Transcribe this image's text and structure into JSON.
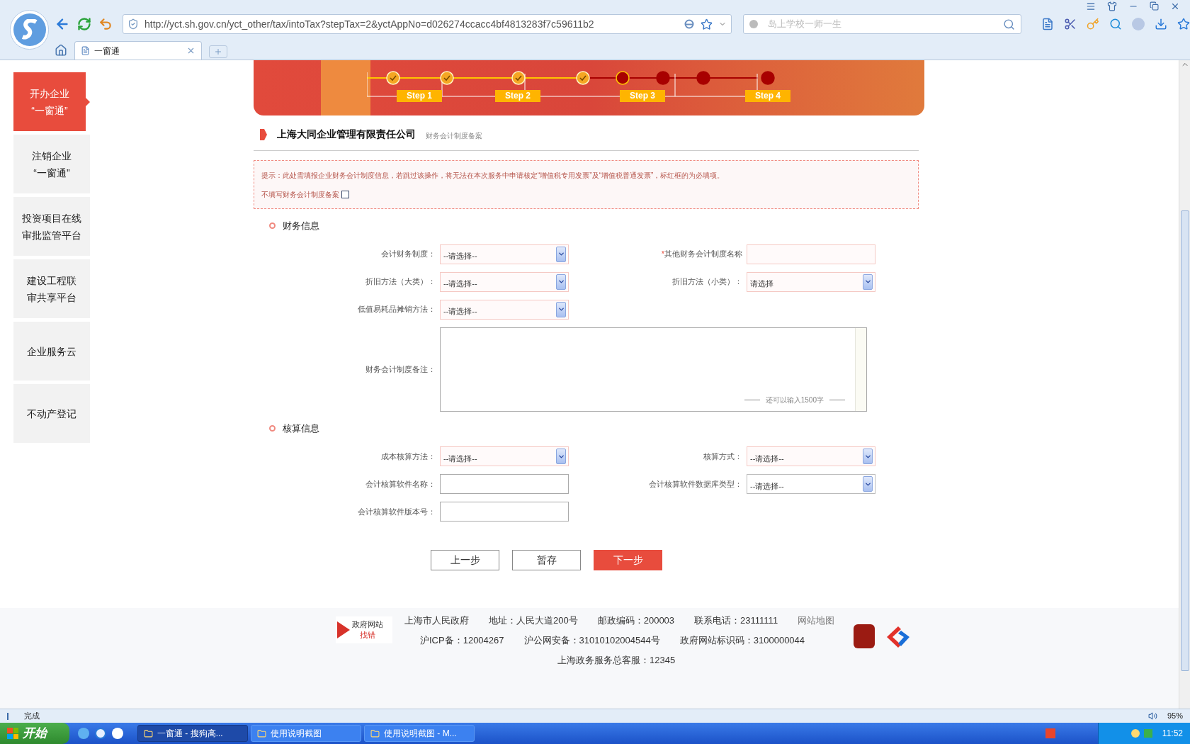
{
  "browser": {
    "address": "http://yct.sh.gov.cn/yct_other/tax/intoTax?stepTax=2&yctAppNo=d026274ccacc4bf4813283f7c59611b2",
    "search_placeholder": "岛上学校一师一生",
    "tabs": [
      {
        "label": "一窗通",
        "selected": true
      }
    ]
  },
  "sidebar": {
    "items": [
      {
        "lines": [
          "开办企业",
          "“一窗通”"
        ],
        "selected": true
      },
      {
        "lines": [
          "注销企业",
          "“一窗通”"
        ],
        "selected": false
      },
      {
        "lines": [
          "投资项目在线",
          "审批监管平台"
        ],
        "selected": false
      },
      {
        "lines": [
          "建设工程联",
          "审共享平台"
        ],
        "selected": false
      },
      {
        "lines": [
          "企业服务云"
        ],
        "selected": false
      },
      {
        "lines": [
          "不动产登记"
        ],
        "selected": false
      }
    ]
  },
  "progress": {
    "steps": [
      {
        "done": true,
        "current": false
      },
      {
        "done": true,
        "current": false
      },
      {
        "done": true,
        "current": false
      },
      {
        "done": true,
        "current": false
      },
      {
        "done": false,
        "current": true
      },
      {
        "done": false,
        "current": false
      },
      {
        "done": false,
        "current": false
      },
      {
        "done": false,
        "current": false
      }
    ],
    "labels": [
      "Step 1",
      "Step 2",
      "Step 3",
      "Step 4"
    ]
  },
  "company": {
    "name": "上海大同企业管理有限责任公司",
    "subtitle": "财务会计制度备案"
  },
  "notice": {
    "text": "提示：此处需填报企业财务会计制度信息，若跳过该操作，将无法在本次服务中申请核定“增值税专用发票”及“增值税普通发票”，标红框的为必填项。",
    "skip_label": "不填写财务会计制度备案",
    "skip_checked": false
  },
  "sections": [
    {
      "title": "财务信息",
      "rows": [
        [
          {
            "label": "会计财务制度：",
            "kind": "select",
            "value": "--请选择--",
            "required": true
          },
          {
            "label": "其他财务会计制度名称",
            "kind": "input",
            "required": true,
            "star": "*"
          }
        ],
        [
          {
            "label": "折旧方法（大类）：",
            "kind": "select",
            "value": "--请选择--",
            "required": true
          },
          {
            "label": "折旧方法（小类）：",
            "kind": "select",
            "value": "请选择",
            "required": true
          }
        ],
        [
          {
            "label": "低值易耗品摊销方法：",
            "kind": "select",
            "value": "--请选择--",
            "required": true
          }
        ],
        [
          {
            "label": "财务会计制度备注：",
            "kind": "textarea",
            "counter": "还可以输入1500字",
            "required": false
          }
        ]
      ]
    },
    {
      "title": "核算信息",
      "rows": [
        [
          {
            "label": "成本核算方法：",
            "kind": "select",
            "value": "--请选择--",
            "required": true
          },
          {
            "label": "核算方式：",
            "kind": "select",
            "value": "--请选择--",
            "required": true
          }
        ],
        [
          {
            "label": "会计核算软件名称：",
            "kind": "input",
            "required": false
          },
          {
            "label": "会计核算软件数据库类型：",
            "kind": "select",
            "value": "--请选择--",
            "required": false
          }
        ],
        [
          {
            "label": "会计核算软件版本号：",
            "kind": "input",
            "required": false
          }
        ]
      ]
    }
  ],
  "buttons": [
    {
      "label": "上一步",
      "kind": "secondary"
    },
    {
      "label": "暂存",
      "kind": "secondary"
    },
    {
      "label": "下一步",
      "kind": "primary"
    }
  ],
  "footer": {
    "badge_top": "政府网站",
    "badge_bottom": "找错",
    "lines": [
      [
        "上海市人民政府",
        "地址：人民大道200号",
        "邮政编码：200003",
        "联系电话：23111111",
        "网站地图"
      ],
      [
        "沪ICP备：12004267",
        "沪公网安备：31010102004544号",
        "政府网站标识码：3100000044"
      ],
      [
        "上海政务服务总客服：12345"
      ]
    ]
  },
  "status_bar": {
    "text": "完成",
    "zoom": "95%"
  },
  "taskbar": {
    "start": "开始",
    "tasks": [
      {
        "label": "一窗通 - 搜狗高...",
        "selected": true
      },
      {
        "label": "使用说明截图",
        "selected": false
      },
      {
        "label": "使用说明截图 - M...",
        "selected": false
      }
    ],
    "clock": "11:52"
  }
}
